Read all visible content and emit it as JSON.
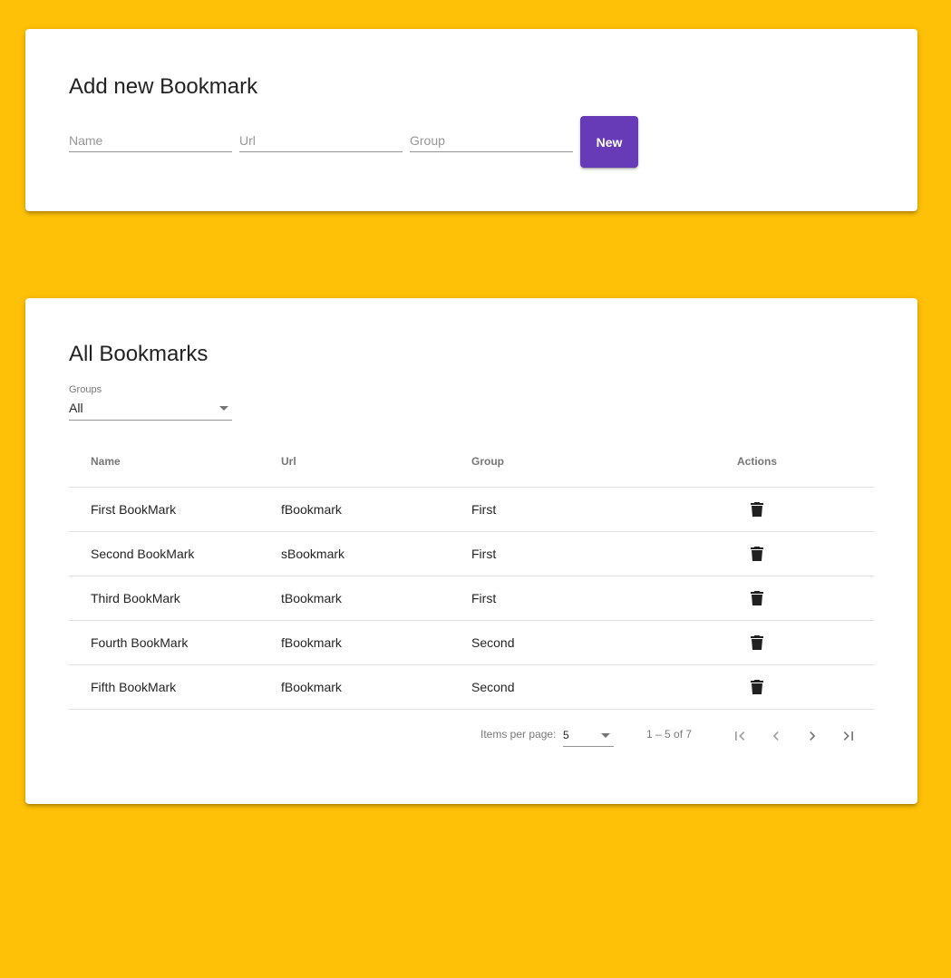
{
  "add_card": {
    "title": "Add new Bookmark",
    "name_placeholder": "Name",
    "url_placeholder": "Url",
    "group_placeholder": "Group",
    "new_button_label": "New"
  },
  "list_card": {
    "title": "All Bookmarks",
    "group_filter": {
      "label": "Groups",
      "value": "All"
    },
    "columns": {
      "name": "Name",
      "url": "Url",
      "group": "Group",
      "actions": "Actions"
    },
    "rows": [
      {
        "name": "First BookMark",
        "url": "fBookmark",
        "group": "First",
        "action_icon": "trash-icon"
      },
      {
        "name": "Second BookMark",
        "url": "sBookmark",
        "group": "First",
        "action_icon": "trash-icon"
      },
      {
        "name": "Third BookMark",
        "url": "tBookmark",
        "group": "First",
        "action_icon": "trash-icon"
      },
      {
        "name": "Fourth BookMark",
        "url": "fBookmark",
        "group": "Second",
        "action_icon": "trash-icon"
      },
      {
        "name": "Fifth BookMark",
        "url": "fBookmark",
        "group": "Second",
        "action_icon": "trash-icon"
      }
    ],
    "paginator": {
      "items_per_page_label": "Items per page:",
      "page_size": "5",
      "range_label": "1 – 5 of 7",
      "icons": [
        "first-page-icon",
        "previous-page-icon",
        "next-page-icon",
        "last-page-icon"
      ]
    }
  },
  "colors": {
    "background": "#ffc107",
    "primary": "#673ab7",
    "card": "#ffffff"
  }
}
